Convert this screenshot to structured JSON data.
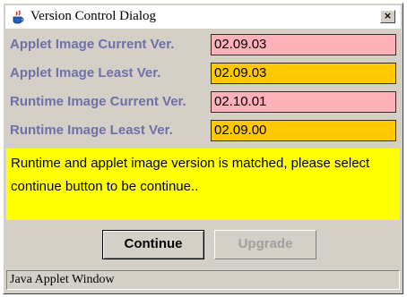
{
  "window": {
    "title": "Version Control Dialog",
    "close_label": "×",
    "icon": "java-coffee-cup-icon"
  },
  "rows": [
    {
      "label": "Applet Image Current Ver.",
      "value": "02.09.03",
      "color": "#ffb0b8"
    },
    {
      "label": "Applet Image Least Ver.",
      "value": "02.09.03",
      "color": "#ffc800"
    },
    {
      "label": "Runtime Image Current Ver.",
      "value": "02.10.01",
      "color": "#ffb0b8"
    },
    {
      "label": "Runtime Image Least Ver.",
      "value": "02.09.00",
      "color": "#ffc800"
    }
  ],
  "message": "Runtime and applet image version is matched, please select continue button to be continue..",
  "buttons": {
    "continue_label": "Continue",
    "upgrade_label": "Upgrade"
  },
  "status": "Java Applet Window",
  "colors": {
    "label_text": "#7070a8",
    "message_background": "#ffff00",
    "dialog_background": "#d4d0c8"
  }
}
